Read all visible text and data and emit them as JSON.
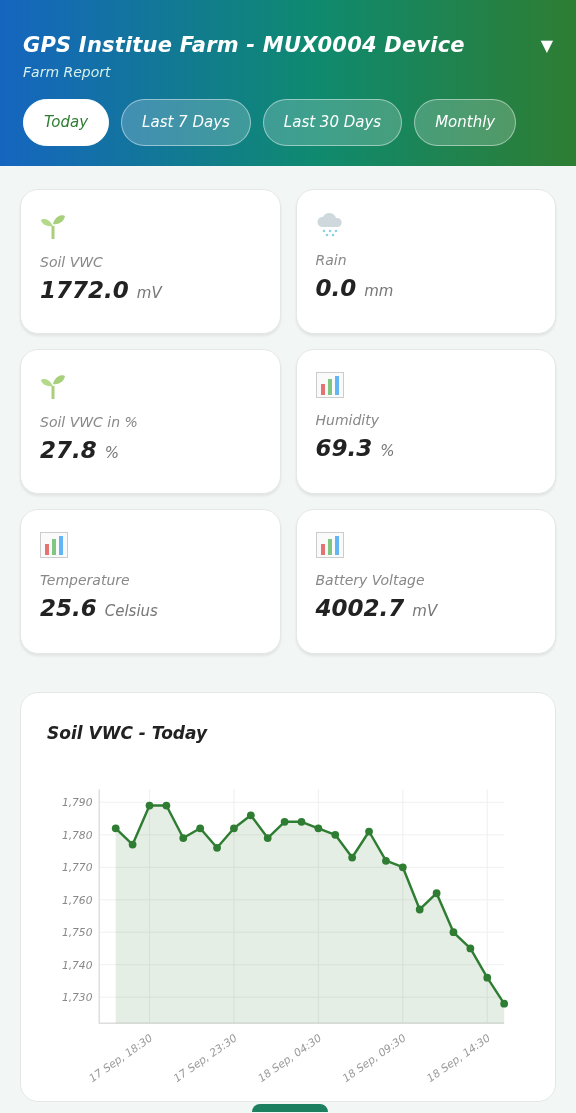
{
  "header": {
    "title": "GPS Institue Farm - MUX0004 Device",
    "subtitle": "Farm Report",
    "menu_glyph": "▼"
  },
  "tabs": [
    {
      "label": "Today",
      "selected": true
    },
    {
      "label": "Last 7 Days",
      "selected": false
    },
    {
      "label": "Last 30 Days",
      "selected": false
    },
    {
      "label": "Monthly",
      "selected": false
    }
  ],
  "metrics": [
    {
      "kind": "seedling",
      "label": "Soil VWC",
      "value": "1772.0",
      "unit": "mV"
    },
    {
      "kind": "rain",
      "label": "Rain",
      "value": "0.0",
      "unit": "mm"
    },
    {
      "kind": "seedling",
      "label": "Soil VWC in %",
      "value": "27.8",
      "unit": "%"
    },
    {
      "kind": "bars",
      "label": "Humidity",
      "value": "69.3",
      "unit": "%"
    },
    {
      "kind": "bars",
      "label": "Temperature",
      "value": "25.6",
      "unit": "Celsius"
    },
    {
      "kind": "bars",
      "label": "Battery Voltage",
      "value": "4002.7",
      "unit": "mV"
    }
  ],
  "chart": {
    "title": "Soil VWC - Today",
    "chart_data": {
      "type": "area",
      "categories": [
        null,
        null,
        "17 Sep, 18:30",
        null,
        null,
        null,
        null,
        "17 Sep, 23:30",
        null,
        null,
        null,
        null,
        "18 Sep, 04:30",
        null,
        null,
        null,
        null,
        "18 Sep, 09:30",
        null,
        null,
        null,
        null,
        "18 Sep, 14:30",
        null
      ],
      "series": [
        {
          "color": "#2e7d32",
          "values": [
            1782,
            1777,
            1789,
            1789,
            1779,
            1782,
            1776,
            1782,
            1786,
            1779,
            1784,
            1784,
            1782,
            1780,
            1773,
            1781,
            1772,
            1770,
            1757,
            1762,
            1750,
            1745,
            1736,
            1728
          ]
        }
      ],
      "ylim": [
        1722,
        1794
      ],
      "grid": true,
      "yticks": [
        {
          "value": 1730,
          "label": "1,730"
        },
        {
          "value": 1740,
          "label": "1,740"
        },
        {
          "value": 1750,
          "label": "1,750"
        },
        {
          "value": 1760,
          "label": "1,760"
        },
        {
          "value": 1770,
          "label": "1,770"
        },
        {
          "value": 1780,
          "label": "1,780"
        },
        {
          "value": 1790,
          "label": "1,790"
        }
      ]
    }
  }
}
